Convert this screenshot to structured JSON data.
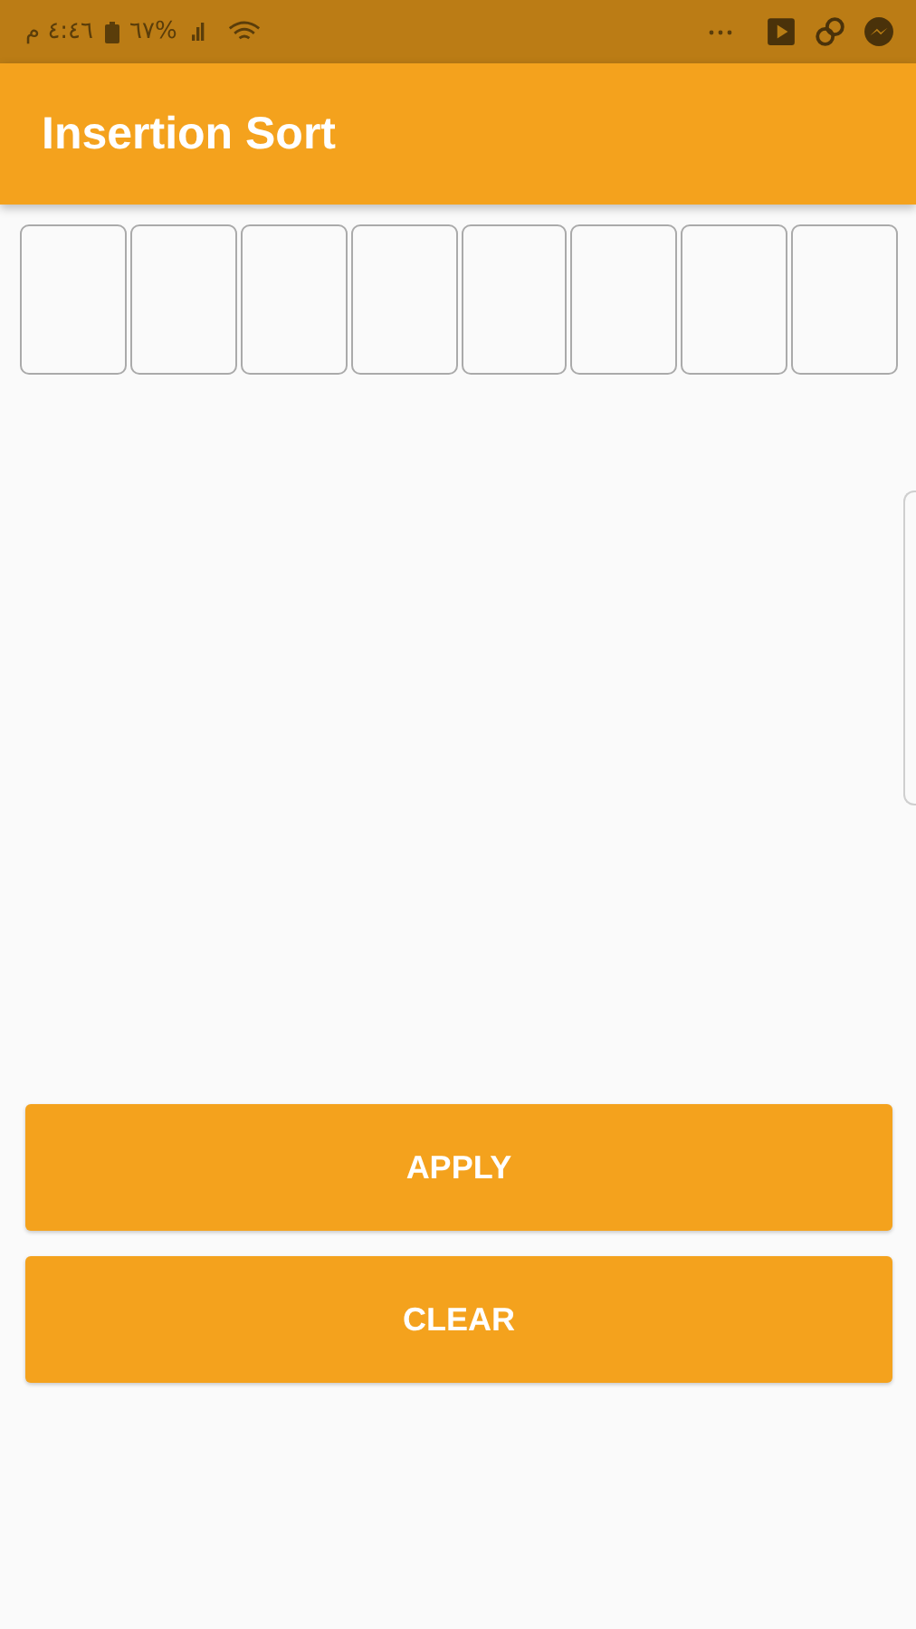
{
  "status_bar": {
    "time": "٤:٤٦ م",
    "battery": "%٦٧"
  },
  "app_bar": {
    "title": "Insertion Sort"
  },
  "array_cells": [
    {
      "kind": "empty"
    },
    {
      "kind": "empty"
    },
    {
      "kind": "empty"
    },
    {
      "kind": "empty"
    },
    {
      "kind": "empty"
    },
    {
      "kind": "empty"
    },
    {
      "kind": "empty"
    },
    {
      "kind": "empty"
    }
  ],
  "buttons": [
    "APPLY",
    "CLEAR"
  ]
}
